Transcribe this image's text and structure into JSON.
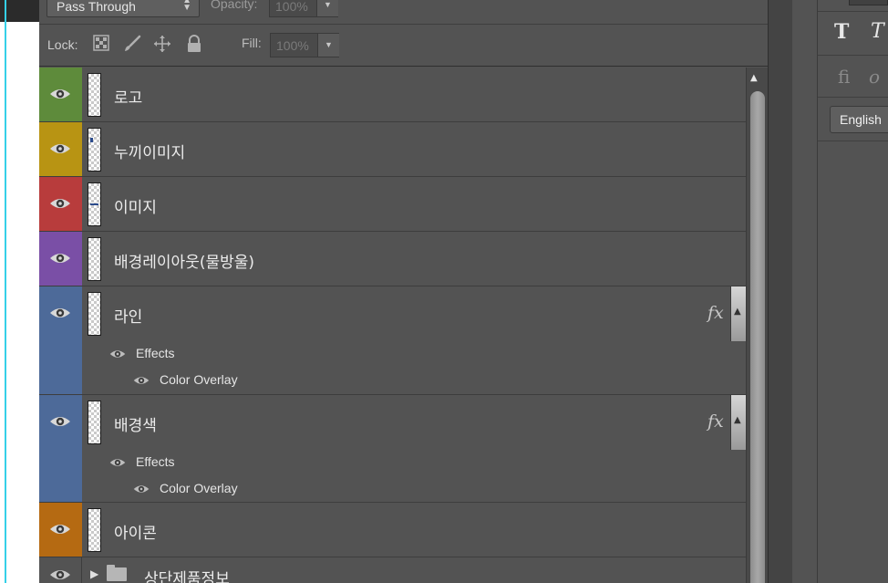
{
  "options_bar": {
    "blend_mode": "Pass Through",
    "opacity_label": "Opacity:",
    "opacity_value": "100%",
    "lock_label": "Lock:",
    "fill_label": "Fill:",
    "fill_value": "100%"
  },
  "layers": [
    {
      "name": "로고",
      "color": "#5e8b3b"
    },
    {
      "name": "누끼이미지",
      "color": "#b89413"
    },
    {
      "name": "이미지",
      "color": "#b83c3c"
    },
    {
      "name": "배경레이아웃(물방울)",
      "color": "#7a4fa6"
    },
    {
      "name": "라인",
      "color": "#4d6a99",
      "fx": "fx",
      "effects_label": "Effects",
      "effect": "Color Overlay"
    },
    {
      "name": "배경색",
      "color": "#4d6a99",
      "fx": "fx",
      "effects_label": "Effects",
      "effect": "Color Overlay"
    },
    {
      "name": "아이콘",
      "color": "#b56a12"
    },
    {
      "name": "상단제품정보",
      "color": "#535353"
    }
  ],
  "right_panel": {
    "bold_glyph": "T",
    "italic_glyph": "T",
    "ligature_glyph": "fi",
    "swash_glyph": "o",
    "language": "English"
  }
}
